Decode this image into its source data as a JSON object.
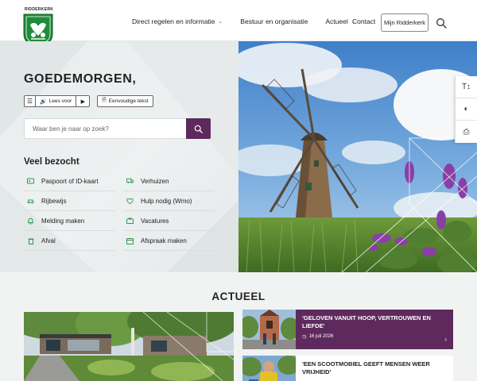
{
  "header": {
    "logo_text": "RIDDERKERK",
    "nav": [
      {
        "label": "Direct regelen en informatie",
        "has_dropdown": true
      },
      {
        "label": "Bestuur en organisatie",
        "has_dropdown": false
      },
      {
        "label": "Actueel",
        "has_dropdown": true
      }
    ],
    "contact_label": "Contact",
    "mijn_label": "Mijn Ridderkerk",
    "search_icon": "search-icon"
  },
  "hero": {
    "greeting": "GOEDEMORGEN,",
    "read_aloud_label": "Lees voor",
    "easy_text_label": "Eenvoudige tekst",
    "search_placeholder": "Waar ben je naar op zoek?"
  },
  "veel_bezocht": {
    "title": "Veel bezocht",
    "left": [
      {
        "label": "Paspoort of ID-kaart",
        "icon": "id-card-icon"
      },
      {
        "label": "Rijbewijs",
        "icon": "driver-license-icon"
      },
      {
        "label": "Melding maken",
        "icon": "bell-icon"
      },
      {
        "label": "Afval",
        "icon": "trash-icon"
      }
    ],
    "right": [
      {
        "label": "Verhuizen",
        "icon": "truck-icon"
      },
      {
        "label": "Hulp nodig (Wmo)",
        "icon": "helping-hands-icon"
      },
      {
        "label": "Vacatures",
        "icon": "briefcase-icon"
      },
      {
        "label": "Afspraak maken",
        "icon": "calendar-icon"
      }
    ]
  },
  "side_tools": [
    {
      "icon": "text-size-icon",
      "glyph": "T↕"
    },
    {
      "icon": "contrast-icon",
      "glyph": "◐"
    },
    {
      "icon": "printer-icon",
      "glyph": "⎙"
    }
  ],
  "actueel": {
    "title": "ACTUEEL",
    "items": [
      {
        "title": "'GELOVEN VANUIT HOOP, VERTROUWEN EN LIEFDE'",
        "date": "16 juli 2026"
      },
      {
        "title": "'EEN SCOOTMOBIEL GEEFT MENSEN WEER VRIJHEID'",
        "date": ""
      }
    ]
  },
  "colors": {
    "brand_purple": "#5e2a5d",
    "brand_green": "#2e9a4a",
    "shield_green": "#1f8c3a"
  }
}
